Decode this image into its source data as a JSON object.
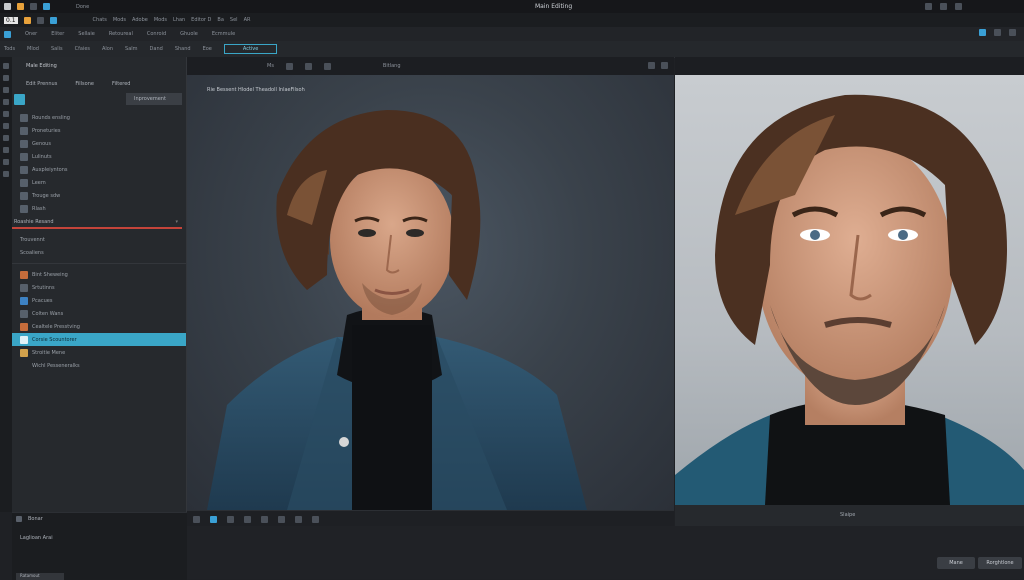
{
  "window": {
    "title": "Main Editing",
    "tab": "Done"
  },
  "menubar": {
    "items": [
      "Chats",
      "Mods",
      "Adobe",
      "Mods",
      "Lhan",
      "Editor D",
      "Ba",
      "Sel",
      "AR"
    ],
    "zoom": "0.1"
  },
  "toolbar1": {
    "items": [
      "Oner",
      "Eliter",
      "Sellaie",
      "Retoureal",
      "Conroid",
      "Ghuole",
      "Ecmmule"
    ]
  },
  "toolbar2": {
    "items": [
      "Tods",
      "Mlod",
      "Salis",
      "Cfaies",
      "Alon",
      "Salm",
      "Dand",
      "Shand",
      "Eoe"
    ],
    "active": "Active"
  },
  "left_panel": {
    "header": "Male Editing",
    "options": [
      "Edit Prennus",
      "Fillsone",
      "Filtered"
    ],
    "dropdown": "Inprovement",
    "layers": [
      "Rounds ensling",
      "Proneturies",
      "Genous",
      "Lulinuts",
      "Auxpleiyntons",
      "Leem",
      "Trouge sdw",
      "Rlash"
    ],
    "section": "Roashie Resand",
    "section_items": [
      "Trouvennt",
      "Scoaliens"
    ],
    "items2": [
      "Bint Sheweing",
      "Srtutinns",
      "Pcacues",
      "Colten Wans",
      "Cealtele Presstving",
      "Corsie Scountorer",
      "Stroitie Mene",
      "Wichl Pesseneralks"
    ],
    "selected": "Corsie Scountorer",
    "bottom": [
      "Bonar",
      "Laglioan Arai"
    ],
    "footer": "Ratamout"
  },
  "canvas": {
    "filename": "Bitlang",
    "caption": "Rie Bessent Hlodel Theadoll InlaeFilsoh",
    "label": "Ms"
  },
  "right_panel": {
    "label": "Slaipe",
    "buttons": [
      "Mane",
      "Rorghtlone"
    ]
  },
  "colors": {
    "accent": "#3aa6c7",
    "divider": "#c4443a"
  }
}
